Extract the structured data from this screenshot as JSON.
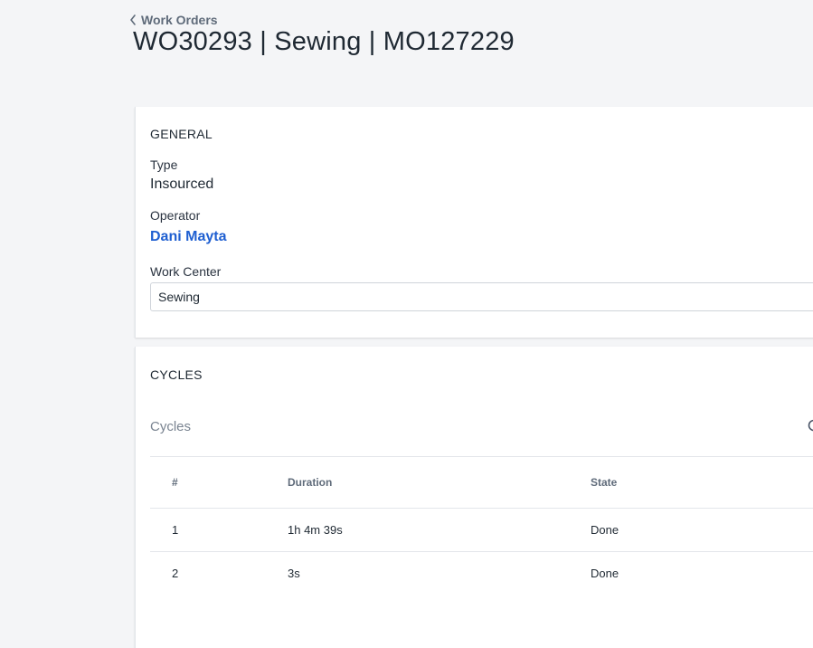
{
  "breadcrumb": {
    "back_label": "Work Orders"
  },
  "page": {
    "title": "WO30293 | Sewing | MO127229"
  },
  "general": {
    "heading": "GENERAL",
    "type_label": "Type",
    "type_value": "Insourced",
    "operator_label": "Operator",
    "operator_value": "Dani Mayta",
    "work_center_label": "Work Center",
    "work_center_value": "Sewing"
  },
  "cycles": {
    "heading": "CYCLES",
    "subheader": "Cycles",
    "columns": [
      "#",
      "Duration",
      "State"
    ],
    "rows": [
      {
        "num": "1",
        "duration": "1h 4m 39s",
        "state": "Done"
      },
      {
        "num": "2",
        "duration": "3s",
        "state": "Done"
      }
    ]
  },
  "colors": {
    "link": "#1f5fd1",
    "background": "#f4f5f7"
  }
}
